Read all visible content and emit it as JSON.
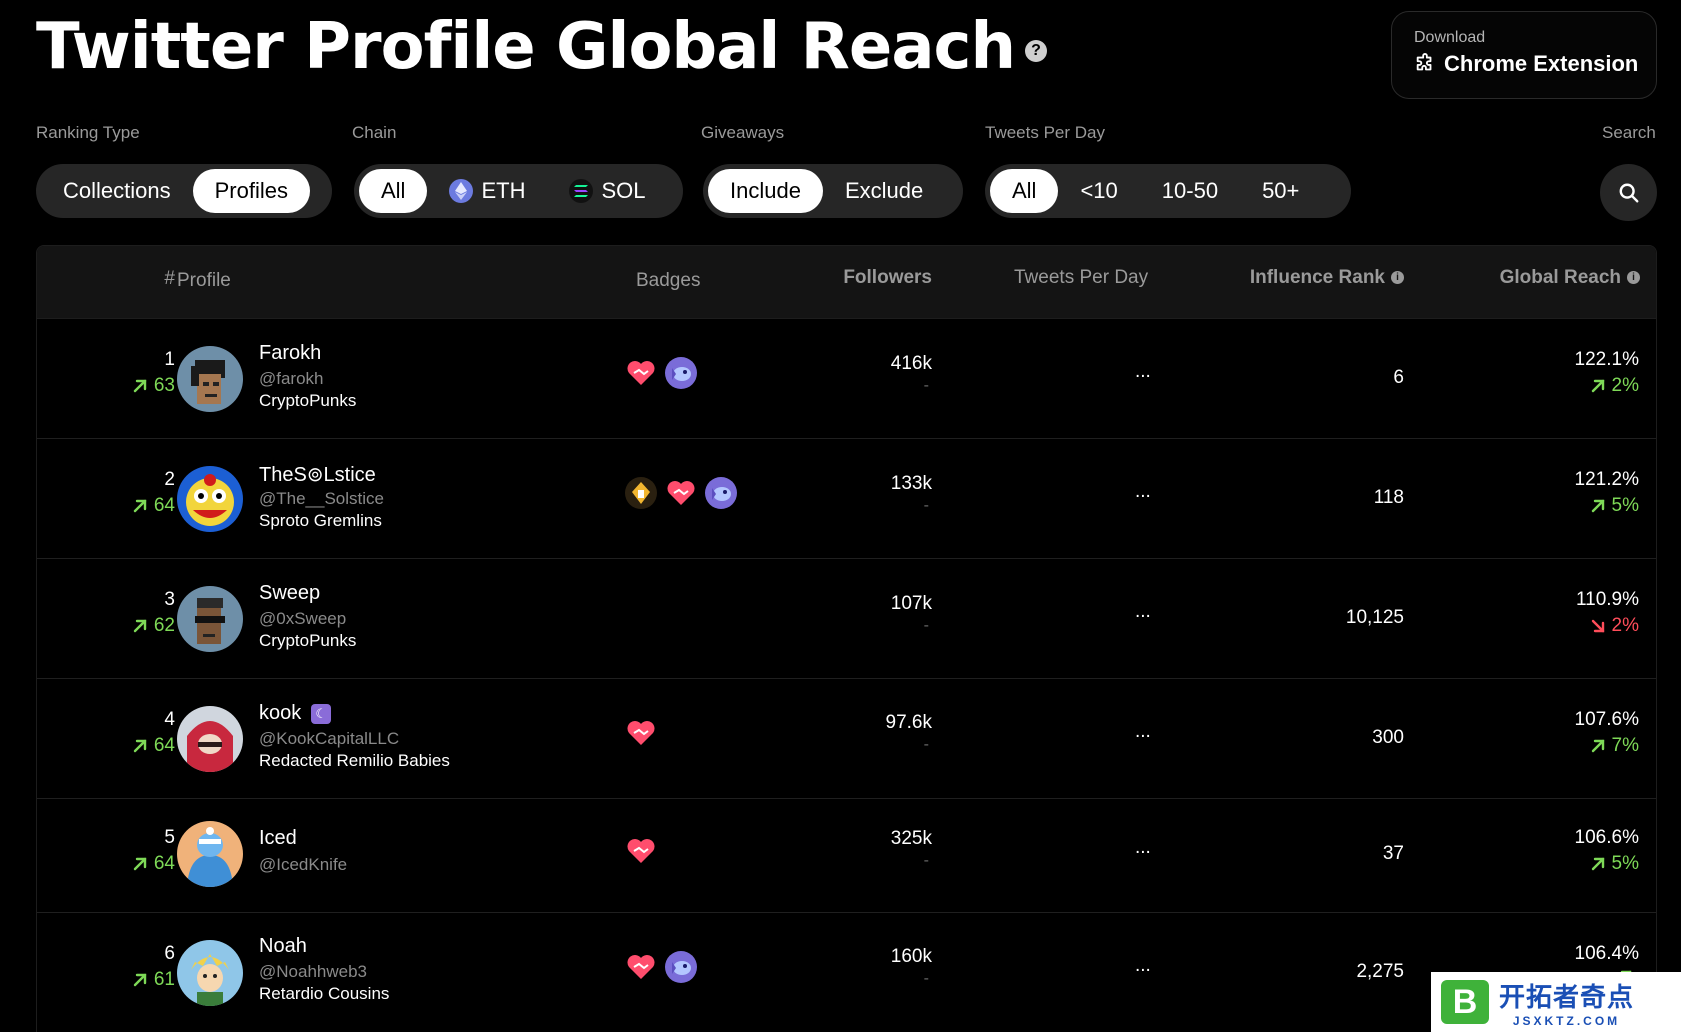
{
  "header": {
    "title": "Twitter Profile Global Reach",
    "help_icon": "question-circle-icon"
  },
  "extension": {
    "small_label": "Download",
    "big_label": "Chrome Extension",
    "icon": "puzzle-piece-icon"
  },
  "filters": {
    "ranking_type": {
      "label": "Ranking Type",
      "options": [
        "Collections",
        "Profiles"
      ],
      "selected": "Profiles"
    },
    "chain": {
      "label": "Chain",
      "options": [
        "All",
        "ETH",
        "SOL"
      ],
      "selected": "All"
    },
    "giveaways": {
      "label": "Giveaways",
      "options": [
        "Include",
        "Exclude"
      ],
      "selected": "Include"
    },
    "tweets_per_day": {
      "label": "Tweets Per Day",
      "options": [
        "All",
        "<10",
        "10-50",
        "50+"
      ],
      "selected": "All"
    },
    "search": {
      "label": "Search",
      "icon": "search-icon"
    }
  },
  "table": {
    "columns": {
      "rank": "#",
      "profile": "Profile",
      "badges": "Badges",
      "followers": "Followers",
      "tweets_per_day": "Tweets Per Day",
      "influence_rank": "Influence Rank",
      "global_reach": "Global Reach"
    },
    "rows": [
      {
        "rank": "1",
        "rank_delta": "63",
        "name": "Farokh",
        "handle": "@farokh",
        "collection": "CryptoPunks",
        "badges": [
          "handshake-heart-icon",
          "purple-fish-icon"
        ],
        "followers": "416k",
        "followers_sub": "-",
        "tweets_per_day": "...",
        "influence_rank": "6",
        "global_reach": "122.1%",
        "reach_delta": "2%",
        "reach_trend": "up"
      },
      {
        "rank": "2",
        "rank_delta": "64",
        "name": "TheS⊚Lstice",
        "handle": "@The__Solstice",
        "collection": "Sproto Gremlins",
        "badges": [
          "golden-bird-icon",
          "handshake-heart-icon",
          "purple-fish-icon"
        ],
        "followers": "133k",
        "followers_sub": "-",
        "tweets_per_day": "...",
        "influence_rank": "118",
        "global_reach": "121.2%",
        "reach_delta": "5%",
        "reach_trend": "up"
      },
      {
        "rank": "3",
        "rank_delta": "62",
        "name": "Sweep",
        "handle": "@0xSweep",
        "collection": "CryptoPunks",
        "badges": [],
        "followers": "107k",
        "followers_sub": "-",
        "tweets_per_day": "...",
        "influence_rank": "10,125",
        "global_reach": "110.9%",
        "reach_delta": "2%",
        "reach_trend": "down"
      },
      {
        "rank": "4",
        "rank_delta": "64",
        "name": "kook",
        "name_badge": "☾",
        "handle": "@KookCapitalLLC",
        "collection": "Redacted Remilio Babies",
        "badges": [
          "handshake-heart-icon"
        ],
        "followers": "97.6k",
        "followers_sub": "-",
        "tweets_per_day": "...",
        "influence_rank": "300",
        "global_reach": "107.6%",
        "reach_delta": "7%",
        "reach_trend": "up"
      },
      {
        "rank": "5",
        "rank_delta": "64",
        "name": "Iced",
        "handle": "@IcedKnife",
        "collection": "",
        "badges": [
          "handshake-heart-icon"
        ],
        "followers": "325k",
        "followers_sub": "-",
        "tweets_per_day": "...",
        "influence_rank": "37",
        "global_reach": "106.6%",
        "reach_delta": "5%",
        "reach_trend": "up"
      },
      {
        "rank": "6",
        "rank_delta": "61",
        "name": "Noah",
        "handle": "@Noahhweb3",
        "collection": "Retardio Cousins",
        "badges": [
          "handshake-heart-icon",
          "purple-fish-icon"
        ],
        "followers": "160k",
        "followers_sub": "-",
        "tweets_per_day": "...",
        "influence_rank": "2,275",
        "global_reach": "106.4%",
        "reach_delta": "",
        "reach_trend": "up"
      }
    ]
  },
  "watermark": {
    "logo_letter": "B",
    "text": "开拓者奇点",
    "url": "JSXKTZ.COM"
  }
}
